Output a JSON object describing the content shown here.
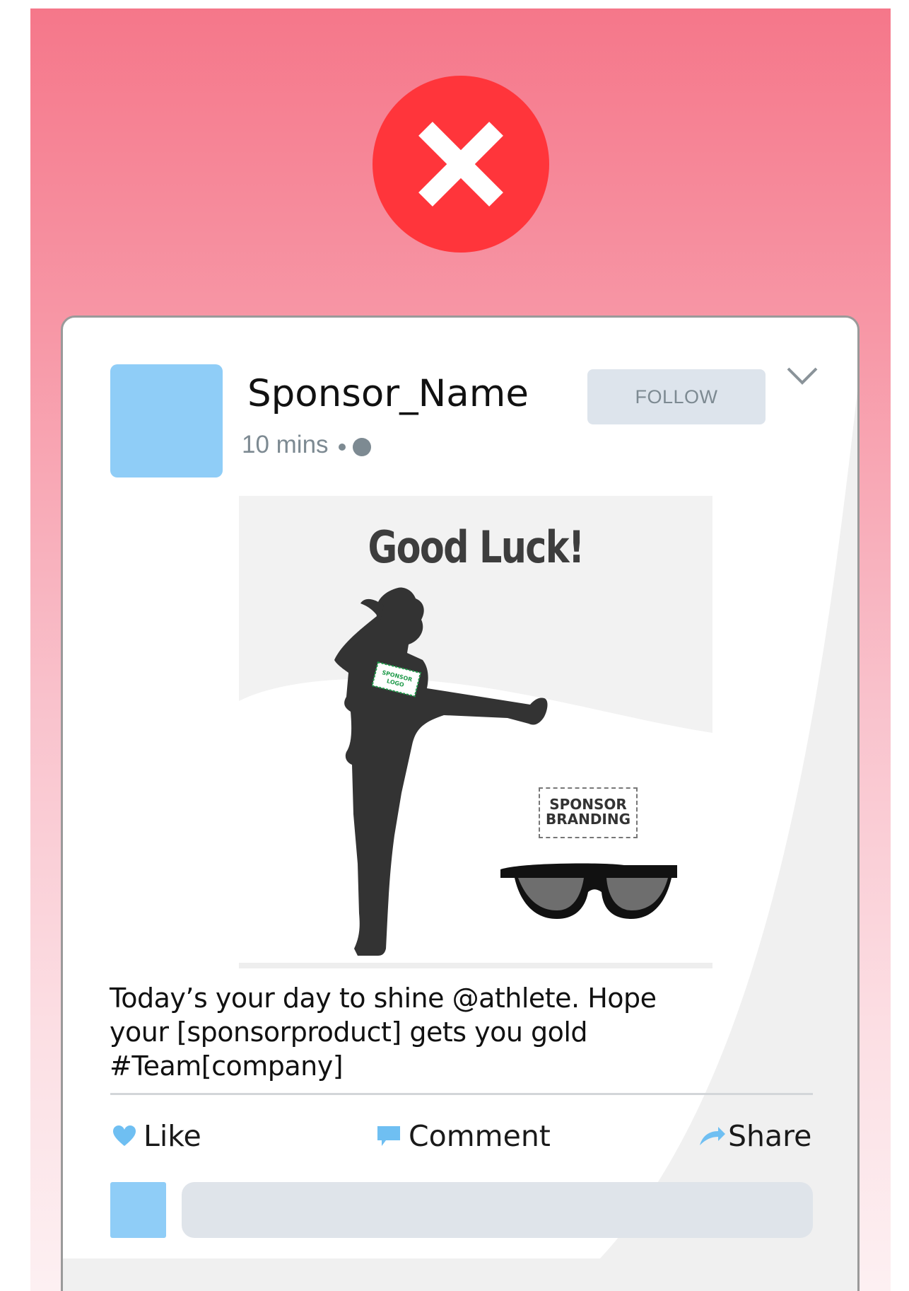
{
  "post": {
    "author": "Sponsor_Name",
    "time": "10 mins",
    "follow_label": "FOLLOW",
    "caption_line1": "Today’s your day to shine @athlete. Hope",
    "caption_line2": "your [sponsorproduct] gets you gold #Team[company]"
  },
  "image": {
    "headline": "Good Luck!",
    "shirt_logo": "SPONSOR LOGO",
    "branding": "SPONSOR\nBRANDING"
  },
  "actions": {
    "like": "Like",
    "comment": "Comment",
    "share": "Share"
  },
  "comment_box": {
    "placeholder": ""
  },
  "icons": {
    "status": "x-icon",
    "like": "heart-icon",
    "comment": "speech-bubble-icon",
    "share": "share-arrow-icon",
    "menu": "chevron-down-icon",
    "privacy": "globe-icon"
  },
  "colors": {
    "banner_top": "#f5778a",
    "x_badge": "#ff353b",
    "avatar": "#8fcdf7",
    "follow_bg": "#dde4ec",
    "meta_text": "#7d8a92",
    "silhouette": "#333333",
    "logo_green": "#1f9a4a"
  }
}
